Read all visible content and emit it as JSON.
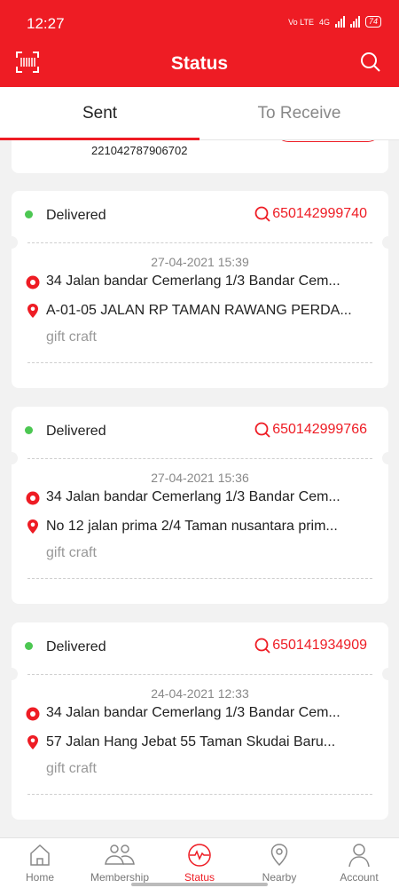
{
  "statusbar": {
    "time": "12:27",
    "network_1": "Vo LTE",
    "network_2": "4G",
    "battery": "74"
  },
  "header": {
    "title": "Status",
    "left_icon": "barcode-scan-icon",
    "right_icon": "search-icon"
  },
  "tabs": [
    {
      "label": "Sent",
      "active": true
    },
    {
      "label": "To Receive",
      "active": false
    }
  ],
  "partial_card": {
    "tracking_number": "221042787906702"
  },
  "shipments": [
    {
      "status": "Delivered",
      "tracking": "650142999740",
      "datetime": "27-04-2021 15:39",
      "from": "34 Jalan bandar Cemerlang 1/3 Bandar Cem...",
      "to": "A-01-05 JALAN RP TAMAN RAWANG PERDA...",
      "item": "gift craft"
    },
    {
      "status": "Delivered",
      "tracking": "650142999766",
      "datetime": "27-04-2021 15:36",
      "from": "34 Jalan bandar Cemerlang 1/3 Bandar Cem...",
      "to": "No 12 jalan prima 2/4 Taman nusantara prim...",
      "item": "gift craft"
    },
    {
      "status": "Delivered",
      "tracking": "650141934909",
      "datetime": "24-04-2021 12:33",
      "from": "34 Jalan bandar Cemerlang 1/3 Bandar Cem...",
      "to": "57 Jalan Hang Jebat 55 Taman Skudai Baru...",
      "item": "gift craft"
    }
  ],
  "bottom_nav": [
    {
      "label": "Home",
      "icon": "home-icon"
    },
    {
      "label": "Membership",
      "icon": "membership-icon"
    },
    {
      "label": "Status",
      "icon": "status-pulse-icon",
      "active": true
    },
    {
      "label": "Nearby",
      "icon": "location-icon"
    },
    {
      "label": "Account",
      "icon": "account-icon"
    }
  ],
  "colors": {
    "brand": "#ee1c24",
    "delivered": "#4cc752"
  }
}
